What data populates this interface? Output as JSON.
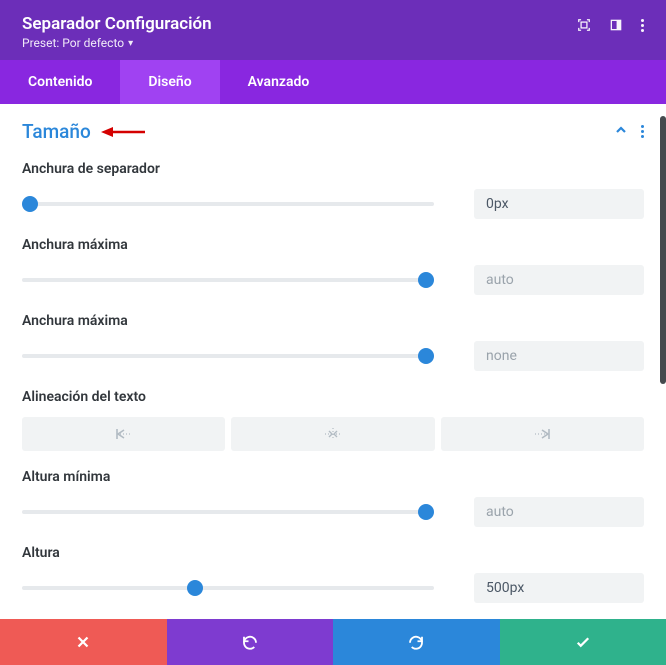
{
  "header": {
    "title": "Separador Configuración",
    "preset_label": "Preset: Por defecto"
  },
  "tabs": {
    "content": "Contenido",
    "design": "Diseño",
    "advanced": "Avanzado"
  },
  "section": {
    "title": "Tamaño"
  },
  "fields": {
    "sep_width": {
      "label": "Anchura de separador",
      "value": "0px",
      "pos_pct": 2
    },
    "max_width_1": {
      "label": "Anchura máxima",
      "value": "auto",
      "placeholder": true,
      "pos_pct": 98
    },
    "max_width_2": {
      "label": "Anchura máxima",
      "value": "none",
      "placeholder": true,
      "pos_pct": 98
    },
    "text_align": {
      "label": "Alineación del texto"
    },
    "min_height": {
      "label": "Altura mínima",
      "value": "auto",
      "placeholder": true,
      "pos_pct": 98
    },
    "height": {
      "label": "Altura",
      "value": "500px",
      "pos_pct": 42
    }
  }
}
